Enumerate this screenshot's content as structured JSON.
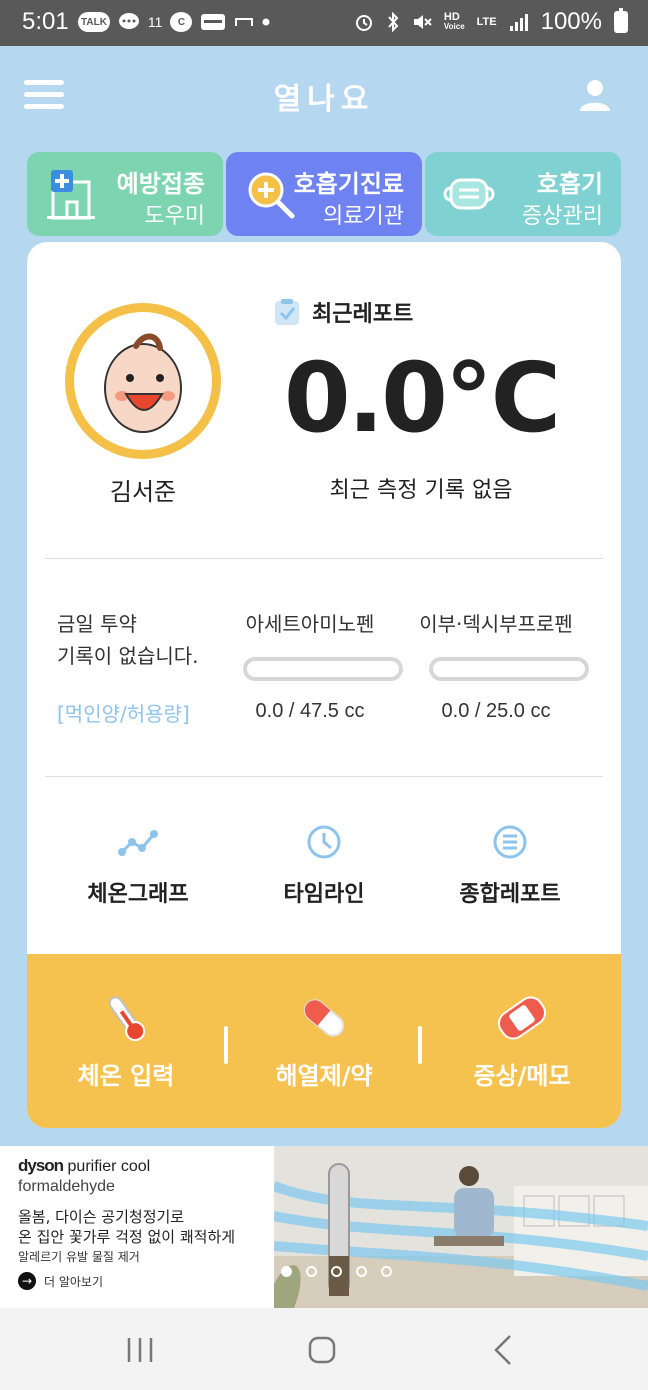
{
  "status_bar": {
    "time": "5:01",
    "left_chips": [
      "TALK",
      "C"
    ],
    "notif_count": "11",
    "hd_label": "HD",
    "hd_sub": "Voice",
    "lte_label": "LTE",
    "battery": "100%"
  },
  "header": {
    "title": "열나요",
    "menu_icon": "hamburger-icon",
    "user_icon": "user-icon"
  },
  "tabs": [
    {
      "title": "예방접종",
      "subtitle": "도우미",
      "color": "#7dd4b0",
      "icon": "hospital-icon"
    },
    {
      "title": "호흡기진료",
      "subtitle": "의료기관",
      "color": "#6f82f2",
      "icon": "search-plus-icon"
    },
    {
      "title": "호흡기",
      "subtitle": "증상관리",
      "color": "#7fd2d1",
      "icon": "mask-icon"
    }
  ],
  "profile": {
    "name": "김서준",
    "avatar_icon": "baby-face-icon",
    "avatar_ring_color": "#f5c048"
  },
  "report": {
    "label": "최근레포트",
    "temperature": "0.0℃",
    "status": "최근 측정 기록 없음"
  },
  "medication": {
    "none_line1": "금일 투약",
    "none_line2": "기록이 없습니다.",
    "dose_label": "[먹인양/허용량]",
    "items": [
      {
        "name": "아세트아미노펜",
        "value": "0.0 / 47.5 cc",
        "fraction": 0
      },
      {
        "name": "이부·덱시부프로펜",
        "value": "0.0 / 25.0 cc",
        "fraction": 0
      }
    ]
  },
  "menu": [
    {
      "label": "체온그래프",
      "icon": "line-graph-icon"
    },
    {
      "label": "타임라인",
      "icon": "clock-icon"
    },
    {
      "label": "종합레포트",
      "icon": "list-icon"
    }
  ],
  "actions": [
    {
      "label": "체온 입력",
      "icon": "thermometer-icon"
    },
    {
      "label": "해열제/약",
      "icon": "pill-icon"
    },
    {
      "label": "증상/메모",
      "icon": "bandage-icon"
    }
  ],
  "ad": {
    "brand_bold": "dyson",
    "brand_rest": "purifier cool",
    "brand_line2": "formaldehyde",
    "copy1": "올봄, 다이슨 공기청정기로",
    "copy2": "온 집안 꽃가루 걱정 없이 쾌적하게",
    "copy3": "알레르기 유발 물질 제거",
    "more": "더 알아보기",
    "dots": 6,
    "active_dot": 1
  },
  "colors": {
    "background": "#b5d7ef",
    "accent_yellow": "#f5c24f",
    "link_blue": "#8dc4ec"
  }
}
